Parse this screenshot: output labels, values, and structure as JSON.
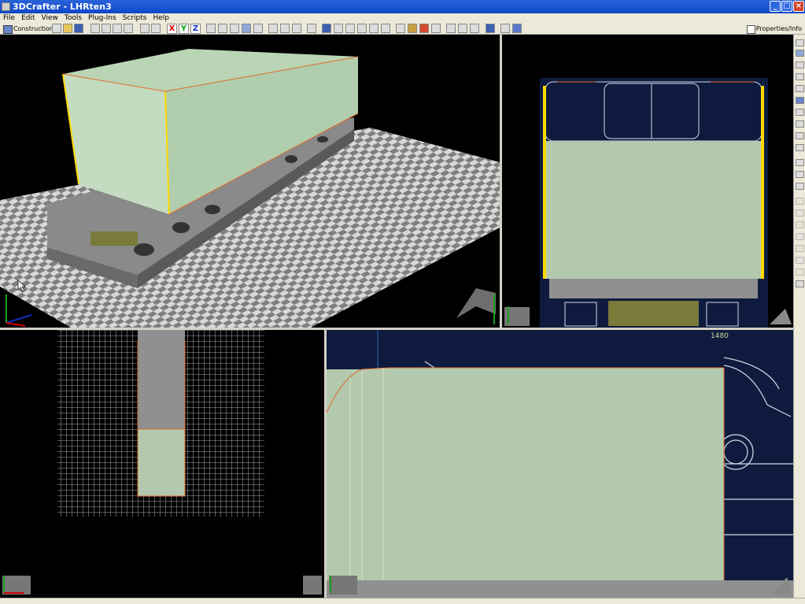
{
  "window": {
    "title": "3DCrafter - LHRten3"
  },
  "menu": {
    "file": "File",
    "edit": "Edit",
    "view": "View",
    "tools": "Tools",
    "plugins": "Plug-Ins",
    "scripts": "Scripts",
    "help": "Help"
  },
  "toolbar": {
    "mode_label": "Construction",
    "axis_x": "X",
    "axis_y": "Y",
    "axis_z": "Z",
    "properties_label": "Properties/Info"
  },
  "viewports": {
    "side": {
      "marking": "1480"
    }
  },
  "colors": {
    "accent_body": "#b9d5b6",
    "floor_light": "#d8d8d8",
    "floor_dark": "#7f7f7f",
    "selection_edge": "#ffd800",
    "blueprint": "#0e1b3e",
    "edge_orange": "#e06a2c"
  }
}
